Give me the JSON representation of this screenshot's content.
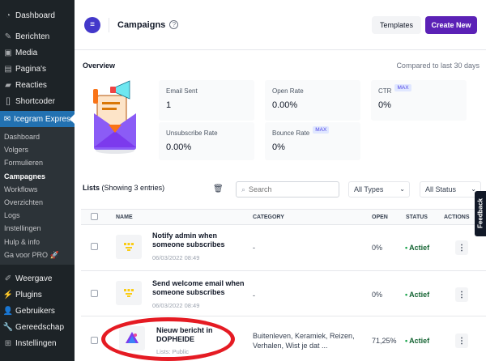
{
  "sidebar": {
    "top_items": [
      {
        "label": "Dashboard",
        "icon": "dashboard-icon"
      },
      {
        "label": "Berichten",
        "icon": "pin-icon"
      },
      {
        "label": "Media",
        "icon": "media-icon"
      },
      {
        "label": "Pagina's",
        "icon": "pages-icon"
      },
      {
        "label": "Reacties",
        "icon": "comments-icon"
      },
      {
        "label": "Shortcoder",
        "icon": "shortcode-icon"
      }
    ],
    "active_item": {
      "label": "Icegram Express",
      "icon": "mail-icon"
    },
    "submenu": [
      "Dashboard",
      "Volgers",
      "Formulieren",
      "Campagnes",
      "Workflows",
      "Overzichten",
      "Logs",
      "Instellingen",
      "Hulp & info",
      "Ga voor PRO"
    ],
    "current_sub": "Campagnes",
    "bottom_items": [
      {
        "label": "Weergave",
        "icon": "brush-icon"
      },
      {
        "label": "Plugins",
        "icon": "plugin-icon"
      },
      {
        "label": "Gebruikers",
        "icon": "users-icon"
      },
      {
        "label": "Gereedschap",
        "icon": "tools-icon"
      },
      {
        "label": "Instellingen",
        "icon": "settings-icon"
      }
    ]
  },
  "header": {
    "title": "Campaigns",
    "templates_label": "Templates",
    "create_label": "Create New"
  },
  "overview": {
    "title": "Overview",
    "compared": "Compared to last 30 days",
    "email_sent": {
      "label": "Email Sent",
      "value": "1"
    },
    "open_rate": {
      "label": "Open Rate",
      "value": "0.00%"
    },
    "ctr": {
      "label": "CTR",
      "badge": "MAX",
      "value": "0%"
    },
    "unsubscribe_rate": {
      "label": "Unsubscribe Rate",
      "value": "0.00%"
    },
    "bounce_rate": {
      "label": "Bounce Rate",
      "badge": "MAX",
      "value": "0%"
    }
  },
  "lists": {
    "title": "Lists",
    "subtitle": "(Showing 3 entries)",
    "search_placeholder": "Search",
    "type_filter": "All Types",
    "status_filter": "All Status"
  },
  "table": {
    "headers": {
      "name": "NAME",
      "category": "CATEGORY",
      "open": "OPEN",
      "status": "STATUS",
      "actions": "ACTIONS"
    },
    "rows": [
      {
        "name": "Notify admin when someone subscribes",
        "date": "06/03/2022 08:49",
        "category": "-",
        "open": "0%",
        "status": "Actief"
      },
      {
        "name": "Send welcome email when someone subscribes",
        "date": "06/03/2022 08:49",
        "category": "-",
        "open": "0%",
        "status": "Actief"
      },
      {
        "name": "Nieuw bericht in DOPHEIDE",
        "date": "Lists: Public",
        "category": "Buitenleven, Keramiek, Reizen, Verhalen, Wist je dat ...",
        "open": "71,25%",
        "status": "Actief"
      }
    ]
  },
  "feedback_label": "Feedback"
}
